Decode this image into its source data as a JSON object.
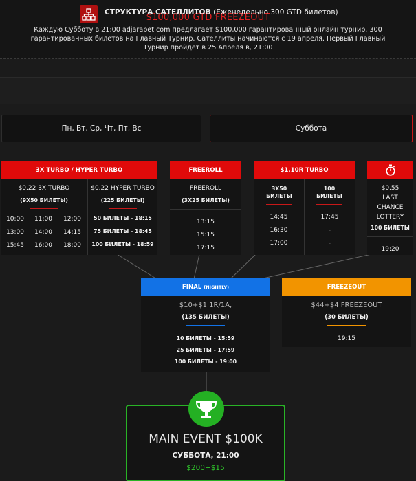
{
  "header": {
    "title": "$100,000 GTD FREEZEOUT",
    "description": "Каждую Субботу в 21:00 adjarabet.com предлагает $100,000 гарантированный онлайн турнир. 300 гарантированных билетов на Главный Турнир. Сателлиты начинаются с 19 апреля. Первый Главный Турнир пройдет в 25 Апреля в, 21:00"
  },
  "structure": {
    "label_bold": "СТРУКТУРА САТЕЛЛИТОВ",
    "label_light": "(Еженедельно 300 GTD билетов)",
    "icon": "sitemap-icon"
  },
  "tabs": [
    {
      "label": "Пн, Вт, Ср, Чт, Пт, Вс",
      "active": false
    },
    {
      "label": "Суббота",
      "active": true
    }
  ],
  "satellites": {
    "turbo": {
      "header": "3X TURBO / HYPER TURBO",
      "left": {
        "name": "$0.22 3X TURBO",
        "tickets": "(9X50 БИЛЕТЫ)",
        "times": [
          "10:00",
          "11:00",
          "12:00",
          "13:00",
          "14:00",
          "14:15",
          "15:45",
          "16:00",
          "18:00"
        ]
      },
      "right": {
        "name": "$0.22 HYPER TURBO",
        "tickets": "(225 БИЛЕТЫ)",
        "rows": [
          "50 БИЛЕТЫ - 18:15",
          "75 БИЛЕТЫ - 18:45",
          "100 БИЛЕТЫ - 18:59"
        ]
      }
    },
    "freeroll": {
      "header": "FREEROLL",
      "name": "FREEROLL",
      "tickets": "(3X25 БИЛЕТЫ)",
      "times": [
        "13:15",
        "15:15",
        "17:15"
      ]
    },
    "turbo110": {
      "header": "$1.10R TURBO",
      "left_label": "3X50 БИЛЕТЫ",
      "right_label": "100 БИЛЕТЫ",
      "left_times": [
        "14:45",
        "16:30",
        "17:00"
      ],
      "right_times": [
        "17:45",
        "-",
        "-"
      ]
    },
    "lottery": {
      "icon": "stopwatch-icon",
      "name_lines": [
        "$0.55",
        "LAST",
        "CHANCE",
        "LOTTERY"
      ],
      "tickets": "100 БИЛЕТЫ",
      "time": "19:20"
    }
  },
  "final": {
    "header": "FINAL",
    "header_small": "(NIGHTLY)",
    "price": "$10+$1 1R/1A,",
    "tickets": "(135 БИЛЕТЫ)",
    "rows": [
      "10 БИЛЕТЫ - 15:59",
      "25 БИЛЕТЫ - 17:59",
      "100 БИЛЕТЫ - 19:00"
    ]
  },
  "freezeout": {
    "header": "FREEZEOUT",
    "price": "$44+$4 FREEZEOUT",
    "tickets": "(30 БИЛЕТЫ)",
    "time": "19:15"
  },
  "main_event": {
    "icon": "trophy-icon",
    "title": "MAIN EVENT $100K",
    "day": "СУББОТА, 21:00",
    "price": "$200+$15"
  },
  "colors": {
    "accent_red": "#e00a0a",
    "final_blue": "#1272e6",
    "freeze_orange": "#f29400",
    "main_green": "#29b326"
  }
}
